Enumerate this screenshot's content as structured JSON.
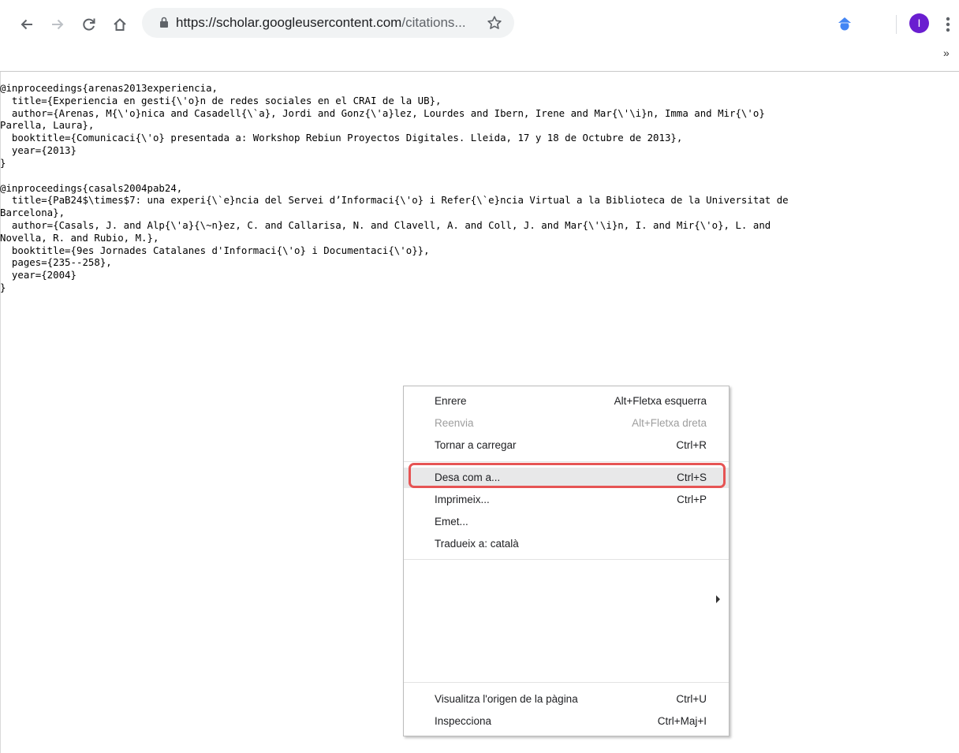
{
  "browser": {
    "url_host": "https://scholar.googleusercontent.com",
    "url_rest": "/citations...",
    "avatar_letter": "I",
    "overflow_chevron": "»",
    "accent": "#6a1ed0"
  },
  "content": {
    "entries": [
      "@inproceedings{arenas2013experiencia,\n  title={Experiencia en gesti{\\'o}n de redes sociales en el CRAI de la UB},\n  author={Arenas, M{\\'o}nica and Casadell{\\`a}, Jordi and Gonz{\\'a}lez, Lourdes and Ibern, Irene and Mar{\\'\\i}n, Imma and Mir{\\'o}\nParella, Laura},\n  booktitle={Comunicaci{\\'o} presentada a: Workshop Rebiun Proyectos Digitales. Lleida, 17 y 18 de Octubre de 2013},\n  year={2013}\n}",
      "@inproceedings{casals2004pab24,\n  title={PaB24$\\times$7: una experi{\\`e}ncia del Servei d’Informaci{\\'o} i Refer{\\`e}ncia Virtual a la Biblioteca de la Universitat de\nBarcelona},\n  author={Casals, J. and Alp{\\'a}{\\~n}ez, C. and Callarisa, N. and Clavell, A. and Coll, J. and Mar{\\'\\i}n, I. and Mir{\\'o}, L. and\nNovella, R. and Rubio, M.},\n  booktitle={9es Jornades Catalanes d'Informaci{\\'o} i Documentaci{\\'o}},\n  pages={235--258},\n  year={2004}\n}"
    ]
  },
  "context_menu": {
    "back": {
      "label": "Enrere",
      "shortcut": "Alt+Fletxa esquerra"
    },
    "forward": {
      "label": "Reenvia",
      "shortcut": "Alt+Fletxa dreta"
    },
    "reload": {
      "label": "Tornar a carregar",
      "shortcut": "Ctrl+R"
    },
    "save_as": {
      "label": "Desa com a...",
      "shortcut": "Ctrl+S"
    },
    "print": {
      "label": "Imprimeix...",
      "shortcut": "Ctrl+P"
    },
    "cast": {
      "label": "Emet..."
    },
    "translate": {
      "label": "Tradueix a: català"
    },
    "view_source": {
      "label": "Visualitza l'origen de la pàgina",
      "shortcut": "Ctrl+U"
    },
    "inspect": {
      "label": "Inspecciona",
      "shortcut": "Ctrl+Maj+I"
    },
    "highlight_color": "#e65454"
  }
}
